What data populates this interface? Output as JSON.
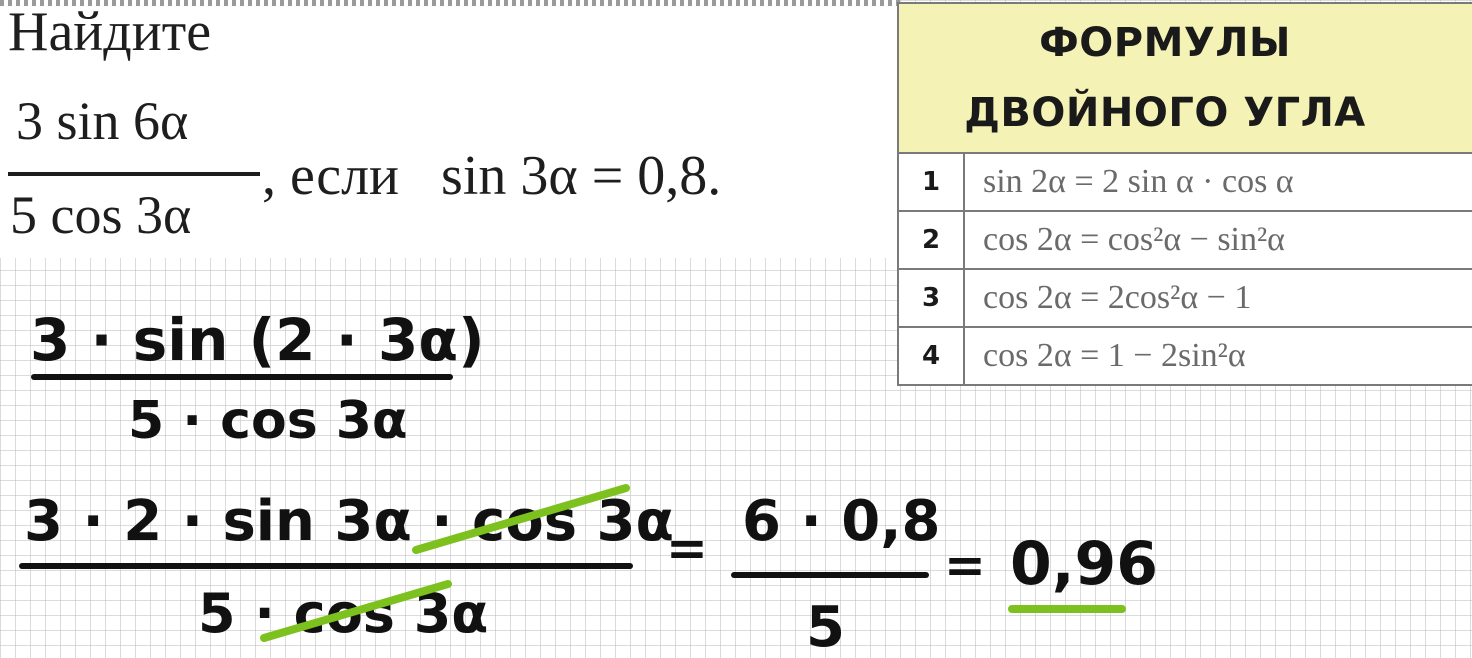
{
  "problem": {
    "title": "Найдите",
    "fraction_numerator": "3 sin 6α",
    "fraction_denominator": "5 cos 3α",
    "condition": ", если   sin 3α = 0,8."
  },
  "formula_table": {
    "header_line1": "ФОРМУЛЫ",
    "header_line2": "ДВОЙНОГО УГЛА",
    "header_color": "#f4f3b5",
    "rows": [
      {
        "n": "1",
        "formula": "sin 2α = 2 sin α · cos α"
      },
      {
        "n": "2",
        "formula": "cos 2α = cos²α − sin²α"
      },
      {
        "n": "3",
        "formula": "cos 2α = 2cos²α − 1"
      },
      {
        "n": "4",
        "formula": "cos 2α = 1 − 2sin²α"
      }
    ]
  },
  "handwritten_solution": {
    "step1_numerator": "3 · sin (2 · 3α)",
    "step1_denominator": "5 · cos 3α",
    "step2_numerator": "3 · 2 · sin 3α · cos 3α",
    "step2_denominator": "5 · cos 3α",
    "equals": "=",
    "step3_numerator": "6 · 0,8",
    "step3_denominator": "5",
    "answer": "0,96",
    "highlight_color": "#7dc11e"
  }
}
